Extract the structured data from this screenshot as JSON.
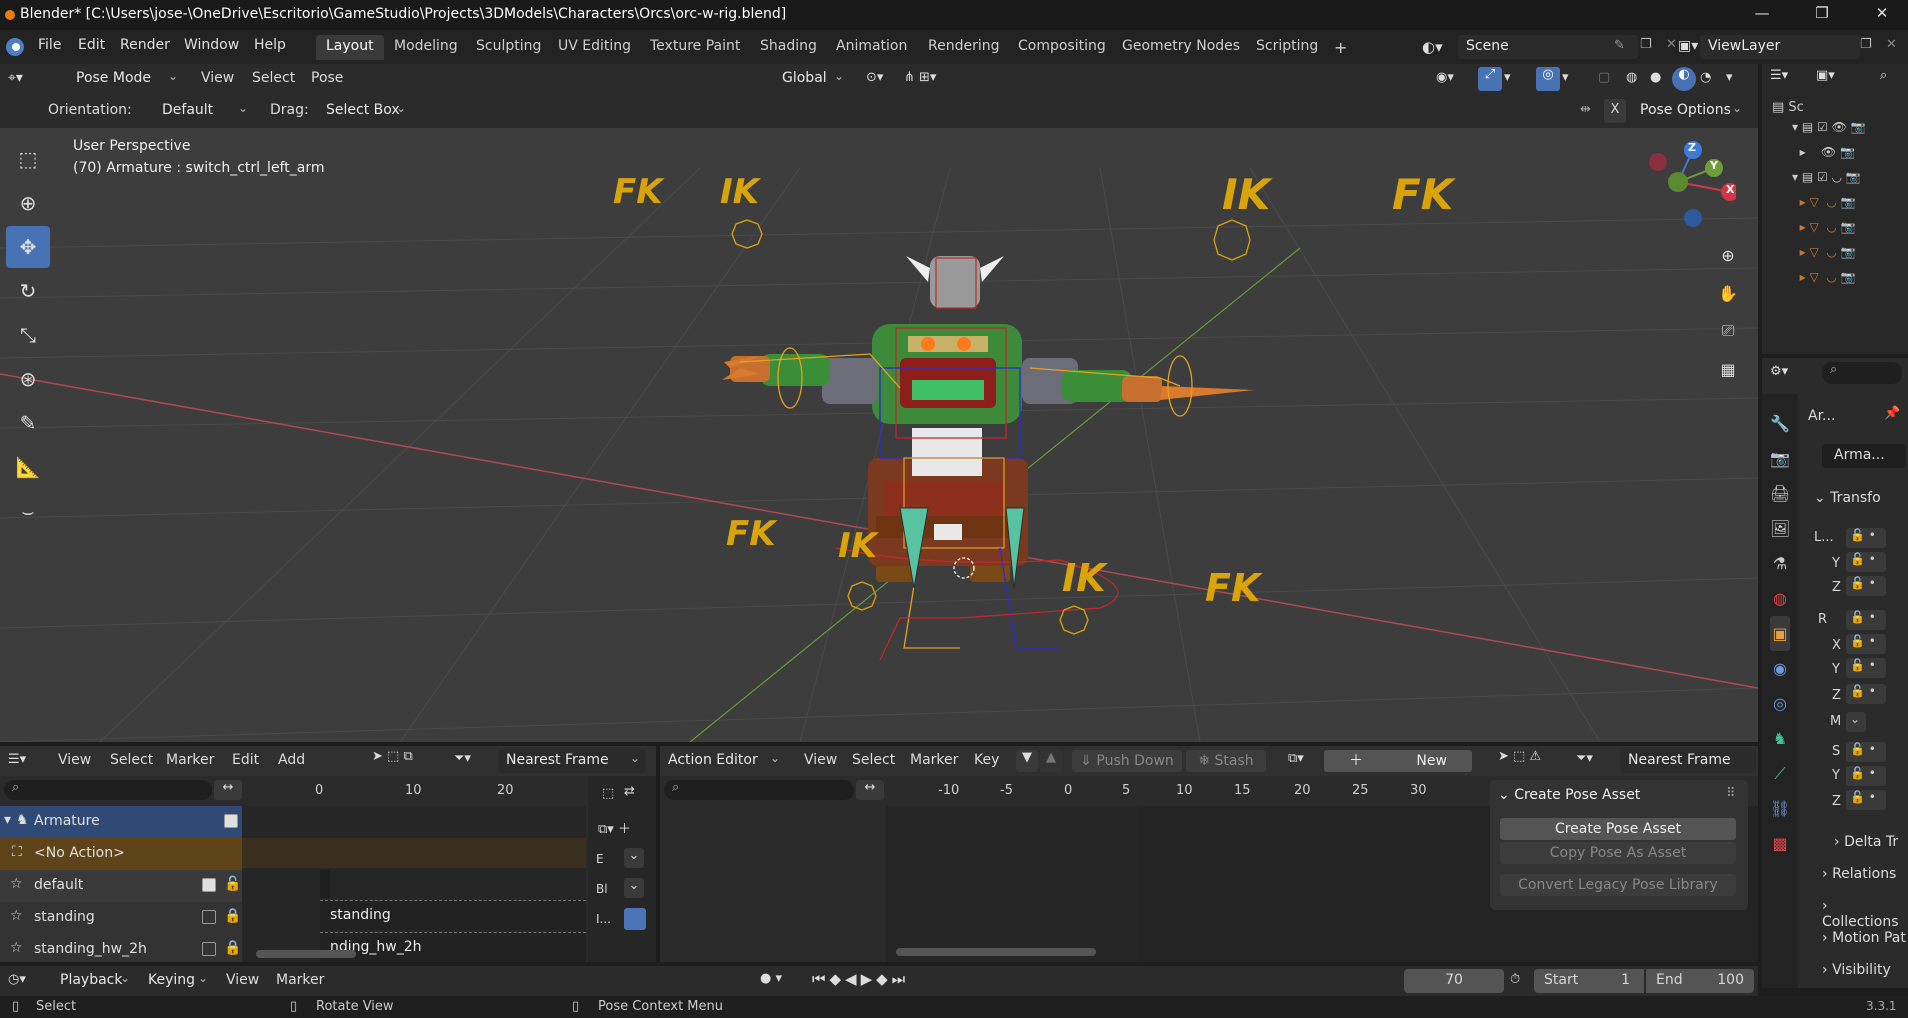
{
  "titlebar": {
    "title": "Blender* [C:\\Users\\jose-\\OneDrive\\Escritorio\\GameStudio\\Projects\\3DModels\\Characters\\Orcs\\orc-w-rig.blend]",
    "minimize": "—",
    "maximize": "❐",
    "close": "✕"
  },
  "menubar": {
    "menus": [
      "File",
      "Edit",
      "Render",
      "Window",
      "Help"
    ],
    "workspaces": [
      "Layout",
      "Modeling",
      "Sculpting",
      "UV Editing",
      "Texture Paint",
      "Shading",
      "Animation",
      "Rendering",
      "Compositing",
      "Geometry Nodes",
      "Scripting"
    ],
    "active_workspace": "Layout",
    "add_workspace": "+",
    "scene": "Scene",
    "view_layer": "ViewLayer"
  },
  "viewport_header": {
    "mode": "Pose Mode",
    "menus": [
      "View",
      "Select",
      "Pose"
    ],
    "transform_orientation": "Global",
    "orientation_label": "Orientation:",
    "orientation_value": "Default",
    "drag_label": "Drag:",
    "drag_value": "Select Box",
    "x_toggle": "X",
    "pose_options": "Pose Options"
  },
  "viewport": {
    "perspective": "User Perspective",
    "info": "(70) Armature : switch_ctrl_left_arm",
    "labels": [
      "FK",
      "IK",
      "IK",
      "FK",
      "FK",
      "IK",
      "IK",
      "FK"
    ],
    "gizmo": {
      "z": "Z",
      "y": "Y",
      "x": "X"
    }
  },
  "properties": {
    "object_name_short": "Ar...",
    "object_name": "Arma...",
    "transform": "Transfo",
    "rows": [
      "L...",
      "Y",
      "Z",
      "R",
      "X",
      "Y",
      "Z",
      "M",
      "S",
      "Y",
      "Z"
    ],
    "sections": [
      "Delta Tr",
      "Relations",
      "Collections",
      "Motion Pat",
      "Visibility"
    ]
  },
  "nla": {
    "menus": [
      "View",
      "Select",
      "Marker",
      "Edit",
      "Add"
    ],
    "snap": "Nearest Frame",
    "ticks": [
      "0",
      "10",
      "20"
    ],
    "channels": [
      {
        "name": "Armature",
        "checked": true
      },
      {
        "name": "<No Action>"
      },
      {
        "name": "default",
        "checked": true
      },
      {
        "name": "standing",
        "checked": false
      },
      {
        "name": "standing_hw_2h",
        "checked": false
      }
    ],
    "strips": [
      "standing",
      "nding_hw_2h"
    ],
    "side": [
      "E",
      "Bl",
      "I..."
    ]
  },
  "action_editor": {
    "mode": "Action Editor",
    "menus": [
      "View",
      "Select",
      "Marker",
      "Key"
    ],
    "push_down": "Push Down",
    "stash": "Stash",
    "new": "New",
    "snap": "Nearest Frame",
    "ticks": [
      "-10",
      "-5",
      "0",
      "5",
      "10",
      "15",
      "20",
      "25",
      "30"
    ],
    "pose_panel": {
      "title": "Create Pose Asset",
      "create": "Create Pose Asset",
      "copy": "Copy Pose As Asset",
      "convert": "Convert Legacy Pose Library"
    }
  },
  "timeline": {
    "menus": [
      "Playback",
      "Keying",
      "View",
      "Marker"
    ],
    "current_frame": "70",
    "start_label": "Start",
    "start": "1",
    "end_label": "End",
    "end": "100"
  },
  "statusbar": {
    "select": "Select",
    "rotate": "Rotate View",
    "context": "Pose Context Menu",
    "version": "3.3.1"
  }
}
